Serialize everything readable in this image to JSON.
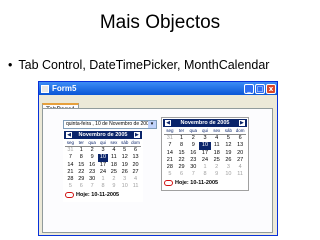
{
  "slide": {
    "title": "Mais Objectos",
    "bullet_marker": "•",
    "bullet": "Tab Control, DateTimePicker, MonthCalendar"
  },
  "window": {
    "title": "Form5",
    "controls": {
      "minimize": "_",
      "maximize": "□",
      "close": "x"
    },
    "tab": "TabPage1"
  },
  "datetimepicker": {
    "value": "quinta-feira , 10 de Novembro de 2005",
    "dropdown_glyph": "▾"
  },
  "calendar_left": {
    "month_title": "Novembro de 2005",
    "prev_glyph": "◀",
    "next_glyph": "▶",
    "weekdays": [
      "seg",
      "ter",
      "qua",
      "qui",
      "sex",
      "sáb",
      "dom"
    ],
    "weeks": [
      [
        {
          "d": "31",
          "o": true
        },
        {
          "d": "1"
        },
        {
          "d": "2"
        },
        {
          "d": "3"
        },
        {
          "d": "4"
        },
        {
          "d": "5"
        },
        {
          "d": "6"
        }
      ],
      [
        {
          "d": "7"
        },
        {
          "d": "8"
        },
        {
          "d": "9"
        },
        {
          "d": "10",
          "s": true
        },
        {
          "d": "11"
        },
        {
          "d": "12"
        },
        {
          "d": "13"
        }
      ],
      [
        {
          "d": "14"
        },
        {
          "d": "15"
        },
        {
          "d": "16"
        },
        {
          "d": "17"
        },
        {
          "d": "18"
        },
        {
          "d": "19"
        },
        {
          "d": "20"
        }
      ],
      [
        {
          "d": "21"
        },
        {
          "d": "22"
        },
        {
          "d": "23"
        },
        {
          "d": "24"
        },
        {
          "d": "25"
        },
        {
          "d": "26"
        },
        {
          "d": "27"
        }
      ],
      [
        {
          "d": "28"
        },
        {
          "d": "29"
        },
        {
          "d": "30"
        },
        {
          "d": "1",
          "o": true
        },
        {
          "d": "2",
          "o": true
        },
        {
          "d": "3",
          "o": true
        },
        {
          "d": "4",
          "o": true
        }
      ],
      [
        {
          "d": "5",
          "o": true
        },
        {
          "d": "6",
          "o": true
        },
        {
          "d": "7",
          "o": true
        },
        {
          "d": "8",
          "o": true
        },
        {
          "d": "9",
          "o": true
        },
        {
          "d": "10",
          "o": true
        },
        {
          "d": "11",
          "o": true
        }
      ]
    ],
    "today_label": "Hoje: 10-11-2005"
  },
  "calendar_right": {
    "month_title": "Novembro de 2005",
    "prev_glyph": "◀",
    "next_glyph": "▶",
    "weekdays": [
      "seg",
      "ter",
      "qua",
      "qui",
      "sex",
      "sáb",
      "dom"
    ],
    "weeks": [
      [
        {
          "d": "31",
          "o": true
        },
        {
          "d": "1"
        },
        {
          "d": "2"
        },
        {
          "d": "3"
        },
        {
          "d": "4"
        },
        {
          "d": "5"
        },
        {
          "d": "6"
        }
      ],
      [
        {
          "d": "7"
        },
        {
          "d": "8"
        },
        {
          "d": "9"
        },
        {
          "d": "10",
          "s": true
        },
        {
          "d": "11"
        },
        {
          "d": "12"
        },
        {
          "d": "13"
        }
      ],
      [
        {
          "d": "14"
        },
        {
          "d": "15"
        },
        {
          "d": "16"
        },
        {
          "d": "17"
        },
        {
          "d": "18"
        },
        {
          "d": "19"
        },
        {
          "d": "20"
        }
      ],
      [
        {
          "d": "21"
        },
        {
          "d": "22"
        },
        {
          "d": "23"
        },
        {
          "d": "24"
        },
        {
          "d": "25"
        },
        {
          "d": "26"
        },
        {
          "d": "27"
        }
      ],
      [
        {
          "d": "28"
        },
        {
          "d": "29"
        },
        {
          "d": "30"
        },
        {
          "d": "1",
          "o": true
        },
        {
          "d": "2",
          "o": true
        },
        {
          "d": "3",
          "o": true
        },
        {
          "d": "4",
          "o": true
        }
      ],
      [
        {
          "d": "5",
          "o": true
        },
        {
          "d": "6",
          "o": true
        },
        {
          "d": "7",
          "o": true
        },
        {
          "d": "8",
          "o": true
        },
        {
          "d": "9",
          "o": true
        },
        {
          "d": "10",
          "o": true
        },
        {
          "d": "11",
          "o": true
        }
      ]
    ],
    "today_label": "Hoje: 10-11-2005"
  }
}
